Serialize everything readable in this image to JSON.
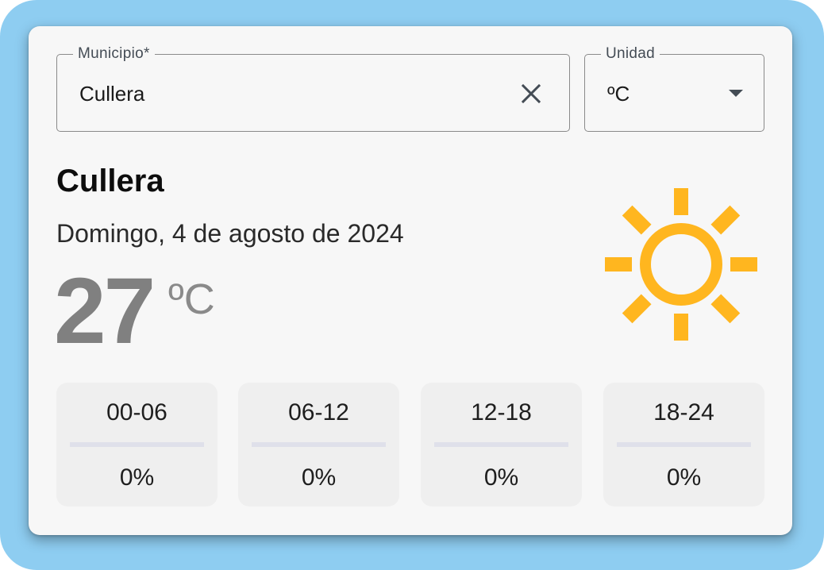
{
  "municipality": {
    "legend": "Municipio*",
    "value": "Cullera",
    "clear_icon": "close-icon"
  },
  "unit_select": {
    "legend": "Unidad",
    "selected": "ºC",
    "arrow_icon": "caret-down-icon"
  },
  "weather": {
    "city": "Cullera",
    "date": "Domingo, 4 de agosto de 2024",
    "temperature": "27",
    "temperature_unit": "ºC",
    "condition_icon": "sun-icon",
    "icon_color": "#ffb61f"
  },
  "periods": [
    {
      "label": "00-06",
      "value": "0%",
      "probability": 0
    },
    {
      "label": "06-12",
      "value": "0%",
      "probability": 0
    },
    {
      "label": "12-18",
      "value": "0%",
      "probability": 0
    },
    {
      "label": "18-24",
      "value": "0%",
      "probability": 0
    }
  ],
  "colors": {
    "frame_background": "#8ecdf1",
    "card_background": "#f7f7f7",
    "period_background": "#efefef",
    "bar_track": "#dfe0ea",
    "temperature_text": "#808080"
  }
}
